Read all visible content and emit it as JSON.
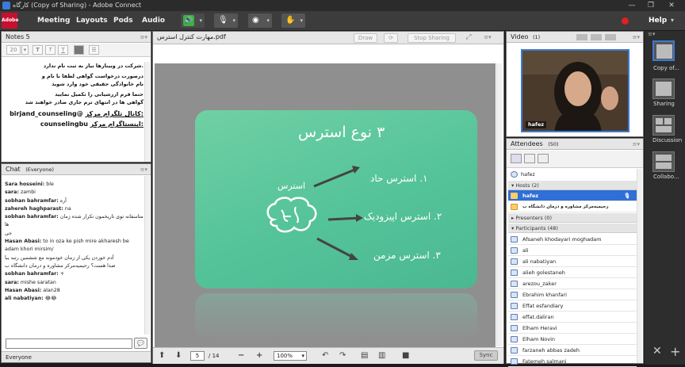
{
  "window": {
    "title": "کارگاه (Copy of Sharing) - Adobe Connect",
    "controls": [
      "—",
      "❐",
      "✕"
    ]
  },
  "menubar": {
    "logo": "Adobe",
    "menus": [
      "Meeting",
      "Layouts",
      "Pods",
      "Audio"
    ],
    "help": "Help"
  },
  "notes": {
    "title": "Notes 5",
    "font_size": "20",
    "toolbar": [
      "T",
      "T",
      "T"
    ],
    "lines": [
      ".شرکت در وبینارها نیاز به ثبت نام ندارد",
      "درصورت درخواست گواهی لطفا با نام و",
      "نام خانوادگی حقیقی خود وارد شوید",
      "حتما فرم ارزشیابی را تکمیل نمایید",
      "گواهی ها در انتهای ترم جاری صادر خواهند شد",
      ":کانال تلگرام مرکز",
      "@birjand_counseling",
      ":اینستاگرام مرکز",
      "counselingbu"
    ]
  },
  "chat": {
    "title": "Chat",
    "scope": "(Everyone)",
    "messages": [
      {
        "name": "Sara hosseini:",
        "text": "ble"
      },
      {
        "name": "sara:",
        "text": "zambi"
      },
      {
        "name": "sobhan bahramfar:",
        "text": "آره"
      },
      {
        "name": "zahereh haghparast:",
        "text": "na"
      },
      {
        "name": "sobhan bahramfar:",
        "text": "متاسفانه توی تاریخمون تکرار شده زمان ها"
      },
      {
        "name": "",
        "text": "جی"
      },
      {
        "name": "Hasan Abasi:",
        "text": "to in oza ke pish mire akharesh be adam khori mirsim/"
      },
      {
        "name": "",
        "text": "آدم خوردن یکی از زمان خودمونه مع ششمین رتبه یبا"
      },
      {
        "name": "",
        "text": "صدا هست؟ رحیمیه‌مرکز مشاوره و درمان دانشگاه ب"
      },
      {
        "name": "sobhan bahramfar:",
        "text": "+"
      },
      {
        "name": "sara:",
        "text": "mishe saratan"
      },
      {
        "name": "Hasan Abasi:",
        "text": "alan28"
      },
      {
        "name": "ali nabatiyan:",
        "text": "😂😂"
      }
    ],
    "footer": "Everyone"
  },
  "share": {
    "title": "مهارت کنترل استرس.pdf",
    "buttons": {
      "draw": "Draw",
      "stop": "Stop Sharing"
    },
    "slide": {
      "heading": "۳ نوع استرس",
      "center": "استرس",
      "items": [
        "۱. استرس حاد",
        "۲. استرس اپیزودیک",
        "۳. استرس مزمن"
      ]
    },
    "footer": {
      "page": "5",
      "total": "/ 14",
      "zoom": "100%",
      "sync": "Sync"
    }
  },
  "video": {
    "title": "Video",
    "count": "(1)",
    "name": "hafez"
  },
  "attendees": {
    "title": "Attendees",
    "count": "(50)",
    "me": "hafez",
    "hosts_label": "Hosts (2)",
    "hosts": [
      "hafez",
      "رحیمیه‌مرکز مشاوره و درمان دانشگاه ب"
    ],
    "presenters_label": "Presenters (0)",
    "participants_label": "Participants (48)",
    "participants": [
      "Afsaneh khodayari moghadam",
      "ali",
      "ali nabatiyan",
      "alieh golestaneh",
      "arezou_zaker",
      "Ebrahim khanfari",
      "Effat esfandiary",
      "effat.daliran",
      "Elham Heravi",
      "Elham Novin",
      "farzaneh abbas zadeh",
      "Fatemeh salmani"
    ]
  },
  "layouts": [
    "Copy of...",
    "Sharing",
    "Discussion",
    "Collabo..."
  ],
  "colors": {
    "accent": "#3a7bd5",
    "slide": "#5cc89e",
    "record": "#e02020"
  }
}
